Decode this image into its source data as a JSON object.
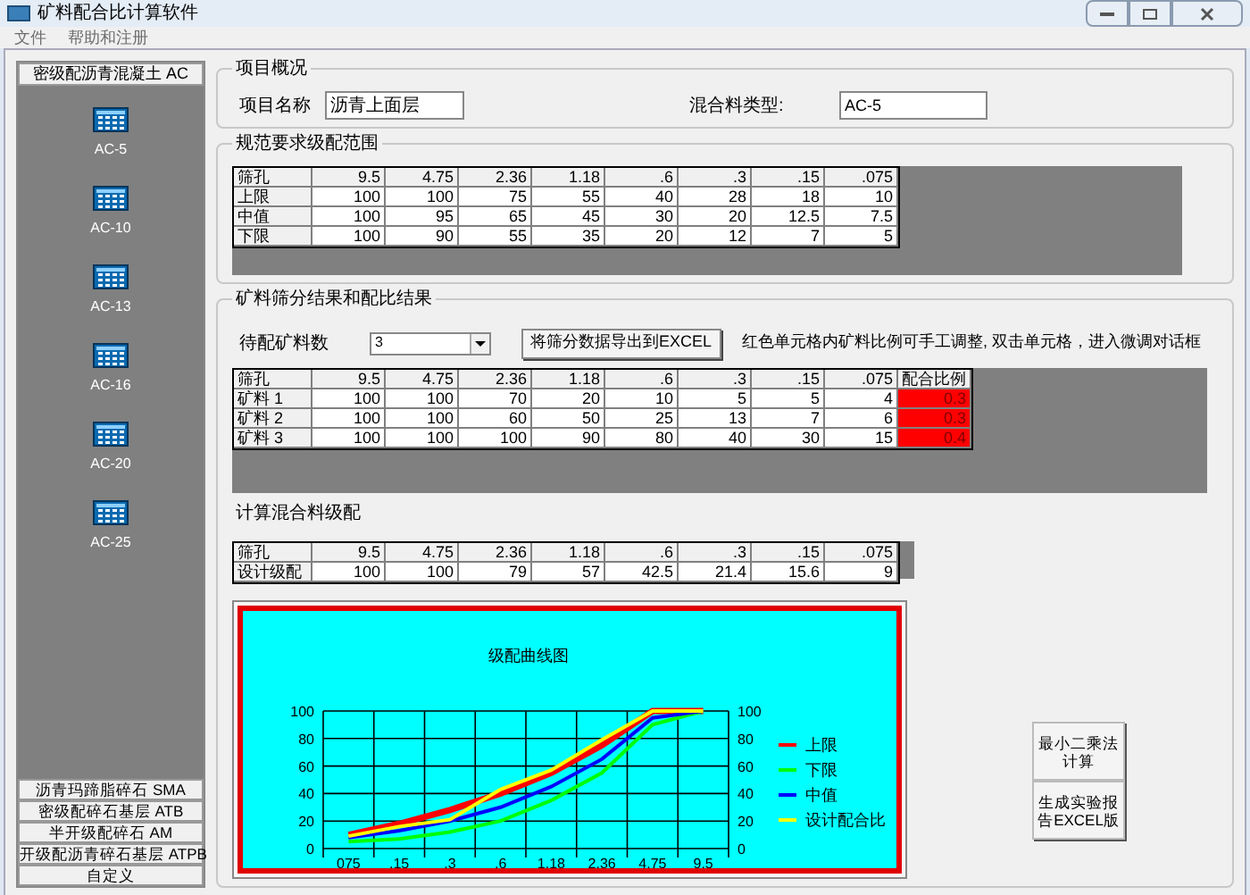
{
  "window": {
    "title": "矿料配合比计算软件"
  },
  "menu": [
    "文件",
    "帮助和注册"
  ],
  "sidebar": {
    "header": "密级配沥青混凝土 AC",
    "items": [
      {
        "label": "AC-5"
      },
      {
        "label": "AC-10"
      },
      {
        "label": "AC-13"
      },
      {
        "label": "AC-16"
      },
      {
        "label": "AC-20"
      },
      {
        "label": "AC-25"
      }
    ],
    "categories": [
      "沥青玛蹄脂碎石 SMA",
      "密级配碎石基层 ATB",
      "半开级配碎石 AM",
      "开级配沥青碎石基层 ATPB",
      "自定义"
    ]
  },
  "project": {
    "title": "项目概况",
    "name_label": "项目名称",
    "name_value": "沥青上面层",
    "type_label": "混合料类型:",
    "type_value": "AC-5"
  },
  "spec": {
    "title": "规范要求级配范围",
    "rows": [
      [
        "筛孔",
        "9.5",
        "4.75",
        "2.36",
        "1.18",
        ".6",
        ".3",
        ".15",
        ".075"
      ],
      [
        "上限",
        "100",
        "100",
        "75",
        "55",
        "40",
        "28",
        "18",
        "10"
      ],
      [
        "中值",
        "100",
        "95",
        "65",
        "45",
        "30",
        "20",
        "12.5",
        "7.5"
      ],
      [
        "下限",
        "100",
        "90",
        "55",
        "35",
        "20",
        "12",
        "7",
        "5"
      ]
    ]
  },
  "sieve": {
    "title": "矿料筛分结果和配比结果",
    "count_label": "待配矿料数",
    "count_value": "3",
    "export_button": "将筛分数据导出到EXCEL",
    "hint": "红色单元格内矿料比例可手工调整, 双击单元格，进入微调对话框",
    "header": [
      "筛孔",
      "9.5",
      "4.75",
      "2.36",
      "1.18",
      ".6",
      ".3",
      ".15",
      ".075",
      "配合比例"
    ],
    "rows": [
      [
        "矿料 1",
        "100",
        "100",
        "70",
        "20",
        "10",
        "5",
        "5",
        "4",
        "0.3"
      ],
      [
        "矿料 2",
        "100",
        "100",
        "60",
        "50",
        "25",
        "13",
        "7",
        "6",
        "0.3"
      ],
      [
        "矿料 3",
        "100",
        "100",
        "100",
        "90",
        "80",
        "40",
        "30",
        "15",
        "0.4"
      ]
    ],
    "mix_title": "计算混合料级配",
    "mix_rows": [
      [
        "筛孔",
        "9.5",
        "4.75",
        "2.36",
        "1.18",
        ".6",
        ".3",
        ".15",
        ".075"
      ],
      [
        "设计级配",
        "100",
        "100",
        "79",
        "57",
        "42.5",
        "21.4",
        "15.6",
        "9"
      ]
    ]
  },
  "chart_data": {
    "type": "line",
    "title": "级配曲线图",
    "categories": [
      "075",
      ".15",
      ".3",
      ".6",
      "1.18",
      "2.36",
      "4.75",
      "9.5"
    ],
    "ylim": [
      0,
      100
    ],
    "yticks": [
      {
        "value": 0,
        "label": "0"
      },
      {
        "value": 20,
        "label": "20"
      },
      {
        "value": 40,
        "label": "40"
      },
      {
        "value": 60,
        "label": "60"
      },
      {
        "value": 80,
        "label": "80"
      },
      {
        "value": 100,
        "label": "100"
      }
    ],
    "y2lim": [
      0,
      100
    ],
    "y2ticks": [
      {
        "value": 0,
        "label": "0"
      },
      {
        "value": 20,
        "label": "20"
      },
      {
        "value": 40,
        "label": "40"
      },
      {
        "value": 60,
        "label": "60"
      },
      {
        "value": 80,
        "label": "80"
      },
      {
        "value": 100,
        "label": "100"
      }
    ],
    "grid": true,
    "legend": true,
    "series": [
      {
        "name": "上限",
        "color": "#ff0000",
        "values": [
          10,
          18,
          28,
          40,
          55,
          75,
          100,
          100
        ]
      },
      {
        "name": "下限",
        "color": "#00ff00",
        "values": [
          5,
          7,
          12,
          20,
          35,
          55,
          90,
          100
        ]
      },
      {
        "name": "中值",
        "color": "#0000ff",
        "values": [
          8,
          13,
          20,
          30,
          45,
          65,
          95,
          100
        ]
      },
      {
        "name": "设计配合比",
        "color": "#ffff00",
        "values": [
          9,
          16,
          21,
          43,
          57,
          79,
          100,
          100
        ]
      }
    ]
  },
  "buttons": [
    "最小二乘法计算",
    "生成实验报告EXCEL版"
  ]
}
